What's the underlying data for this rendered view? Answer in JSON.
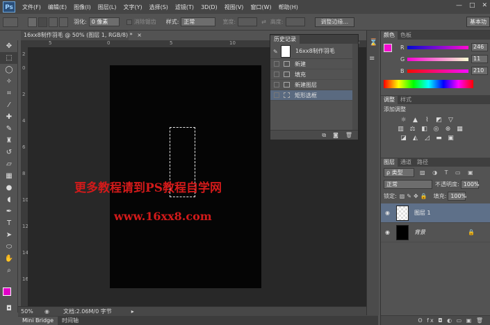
{
  "app": {
    "logo": "Ps"
  },
  "menu": [
    "文件(F)",
    "编辑(E)",
    "图像(I)",
    "图层(L)",
    "文字(Y)",
    "选择(S)",
    "滤镜(T)",
    "3D(D)",
    "视图(V)",
    "窗口(W)",
    "帮助(H)"
  ],
  "window_controls": {
    "minimize": "—",
    "restore": "□",
    "close": "✕"
  },
  "options": {
    "feather_label": "羽化:",
    "feather_value": "0 像素",
    "antialias_label": "消除锯齿",
    "style_label": "样式:",
    "style_value": "正常",
    "width_label": "宽度:",
    "height_label": "高度:",
    "refine_edge": "调整边缘...",
    "workspace": "基本功"
  },
  "document": {
    "tab_title": "16xx8制作羽毛 @ 50% (图层 1, RGB/8) *",
    "tab_close": "×",
    "ruler_ticks": [
      "5",
      "0",
      "5",
      "10",
      "15",
      "20",
      "25"
    ],
    "ruler_left_ticks": [
      "2",
      "0",
      "2",
      "4",
      "6",
      "8",
      "10",
      "12",
      "14",
      "16"
    ],
    "watermark_line1": "更多教程请到PS教程自学网",
    "watermark_line2": "www.16xx8.com"
  },
  "status": {
    "zoom": "50%",
    "doc_info": "文档:2.06M/0 字节"
  },
  "bottom_tabs": [
    "Mini Bridge",
    "时间轴"
  ],
  "history": {
    "tab": "历史记录",
    "snapshot_label": "16xx8制作羽毛",
    "items": [
      {
        "label": "新建"
      },
      {
        "label": "填充"
      },
      {
        "label": "新建图层"
      },
      {
        "label": "矩形选框"
      }
    ],
    "selected_index": 3
  },
  "color_panel": {
    "tabs": [
      "颜色",
      "色板"
    ],
    "r_label": "R",
    "r_value": "246",
    "g_label": "G",
    "g_value": "11",
    "b_label": "B",
    "b_value": "210",
    "foreground": "#f60bd2"
  },
  "adjustments": {
    "tabs": [
      "调整",
      "样式"
    ],
    "title": "添加调整"
  },
  "layers": {
    "tabs": [
      "图层",
      "通道",
      "路径"
    ],
    "filter_label": "ρ 类型",
    "blend_mode": "正常",
    "opacity_label": "不透明度:",
    "opacity_value": "100%",
    "lock_label": "锁定:",
    "fill_label": "填充:",
    "fill_value": "100%",
    "items": [
      {
        "name": "图层 1",
        "selected": true
      },
      {
        "name": "背景",
        "selected": false
      }
    ],
    "footer_icons": "ʘ fx ◘ ◐ ▭ ▣ 🗑"
  }
}
